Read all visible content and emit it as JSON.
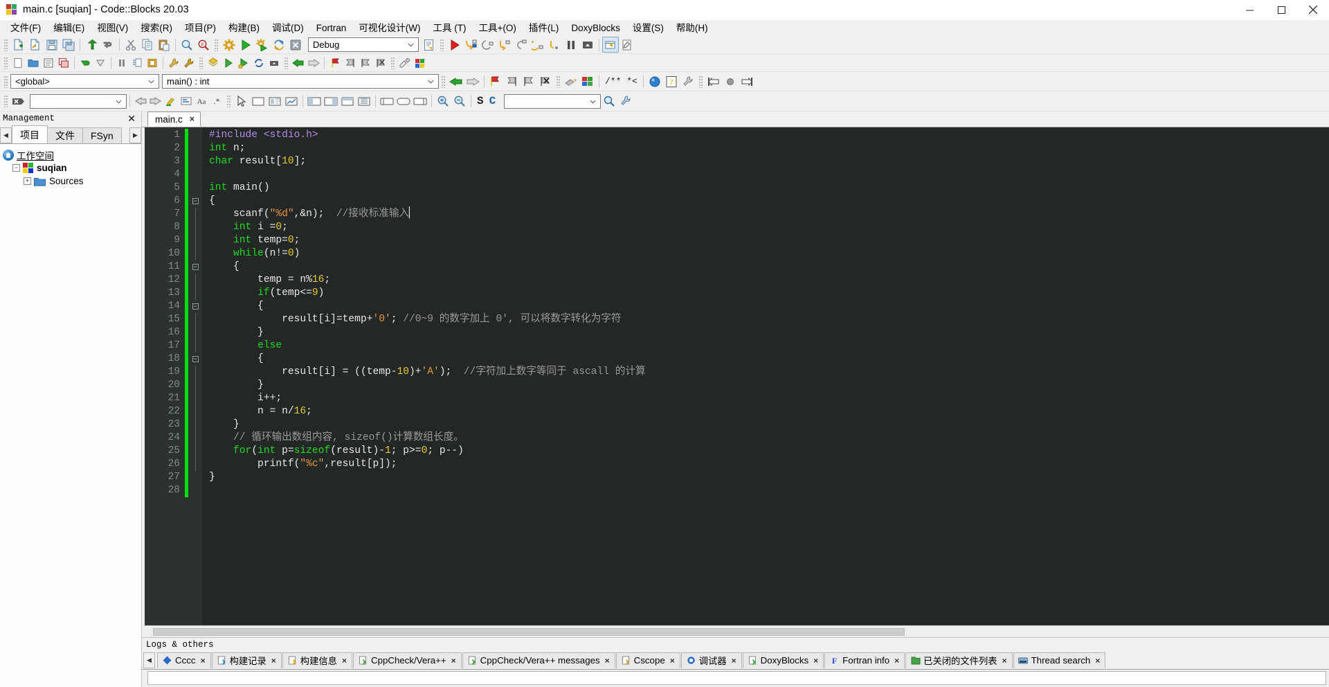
{
  "window": {
    "title": "main.c [suqian] - Code::Blocks 20.03",
    "app_icon": "codeblocks-logo-icon",
    "minimize": "minimize-button",
    "maximize": "maximize-button",
    "close": "close-button"
  },
  "menubar": {
    "items": [
      {
        "label": "文件(F)"
      },
      {
        "label": "编辑(E)"
      },
      {
        "label": "视图(V)"
      },
      {
        "label": "搜索(R)"
      },
      {
        "label": "项目(P)"
      },
      {
        "label": "构建(B)"
      },
      {
        "label": "调试(D)"
      },
      {
        "label": "Fortran"
      },
      {
        "label": "可视化设计(W)"
      },
      {
        "label": "工具 (T)"
      },
      {
        "label": "工具+(O)"
      },
      {
        "label": "插件(L)"
      },
      {
        "label": "DoxyBlocks"
      },
      {
        "label": "设置(S)"
      },
      {
        "label": "帮助(H)"
      }
    ]
  },
  "toolbar_main": {
    "icons": [
      "new-file-icon",
      "open-file-icon",
      "save-icon",
      "save-all-icon",
      "undo-icon",
      "redo-icon",
      "cut-icon",
      "copy-icon",
      "paste-icon",
      "find-icon",
      "replace-icon"
    ],
    "build_icons": [
      "build-icon",
      "run-icon",
      "build-and-run-icon",
      "rebuild-icon",
      "abort-icon"
    ],
    "target_combo": {
      "value": "Debug",
      "name": "build-target-combo"
    },
    "select_target_icon": "select-target-icon"
  },
  "toolbar_debug": {
    "icons": [
      "debug-continue-icon",
      "debug-run-to-cursor-icon",
      "debug-next-line-icon",
      "debug-step-into-icon",
      "debug-step-out-icon",
      "debug-next-instruction-icon",
      "debug-step-into-instruction-icon",
      "debug-break-icon",
      "debug-stop-icon",
      "debugging-windows-icon",
      "various-info-icon"
    ]
  },
  "toolbar_browse": {
    "scope_combo": {
      "value": "<global>",
      "name": "scope-combo"
    },
    "function_combo": {
      "value": "main() : int",
      "name": "function-combo"
    },
    "nav_icons": [
      "back-icon",
      "forward-icon"
    ],
    "bookmark_icons": [
      "toggle-bookmark-icon",
      "prev-bookmark-icon",
      "next-bookmark-icon",
      "clear-bookmarks-icon"
    ],
    "fortran_icons": [
      "fortran-workspace-icon",
      "fortran-jump-icon"
    ],
    "doxy_icons": [
      "doxyblocks-comment-icon",
      "doxyblocks-blockcomment-icon"
    ],
    "doxy_text": "/** *<",
    "doxy_run_icons": [
      "doxyblocks-run-icon",
      "doxyblocks-help-icon",
      "doxyblocks-config-icon"
    ],
    "misc_icons": [
      "align-left-icon",
      "circle-icon",
      "align-right-icon"
    ]
  },
  "toolbar_secondary": {
    "left_icons": [
      "blank-page-icon",
      "open-folder-icon",
      "list-icon",
      "windows-icon",
      "green-arrow-icon",
      "down-chevron-icon",
      "pause-icon",
      "indent-icon",
      "book-icon",
      "wrench1-icon",
      "wrench2-icon"
    ],
    "right_icons": [
      "cursor-icon",
      "rect-tool-icon",
      "image-tool-icon",
      "chart-tool-icon",
      "panel1-icon",
      "panel2-icon",
      "panel3-icon",
      "panel4-icon",
      "shape1-icon",
      "shape2-icon",
      "shape3-icon",
      "zoom-in-icon",
      "zoom-out-icon"
    ],
    "s_label": "S",
    "c_label": "C",
    "search_combo": {
      "value": "",
      "placeholder": "",
      "name": "symbol-search-combo"
    },
    "search_icons": [
      "search-go-icon",
      "search-settings-icon"
    ],
    "close_icon": "close-toolbar-icon",
    "left_combo": {
      "value": "",
      "name": "search-history-combo"
    },
    "nav_icons": [
      "back-arrow-icon",
      "forward-arrow-icon"
    ],
    "highlight_icons": [
      "highlight-icon",
      "selection-icon",
      "case-icon",
      "regex-icon"
    ]
  },
  "sidebar": {
    "panel_title": "Management",
    "close_icon": "close-panel-icon",
    "tabs": [
      {
        "label": "项目",
        "selected": true
      },
      {
        "label": "文件",
        "selected": false
      },
      {
        "label": "FSyn",
        "selected": false
      }
    ],
    "scroll_left_icon": "scroll-left-icon",
    "scroll_right_icon": "scroll-right-icon",
    "tree": [
      {
        "label": "工作空间",
        "icon": "workspace-home-icon",
        "level": 0,
        "style": "link"
      },
      {
        "label": "suqian",
        "icon": "codeblocks-project-icon",
        "level": 1,
        "style": "bold",
        "expander": "-"
      },
      {
        "label": "Sources",
        "icon": "folder-icon",
        "level": 2,
        "style": "normal",
        "expander": "+"
      }
    ]
  },
  "editor": {
    "tabs": [
      {
        "label": "main.c",
        "close": "×",
        "selected": true
      }
    ],
    "lines": [
      {
        "n": 1,
        "changed": true,
        "fold": "",
        "tokens": [
          {
            "t": "#include ",
            "c": "pre"
          },
          {
            "t": "<stdio.h>",
            "c": "pre"
          }
        ]
      },
      {
        "n": 2,
        "changed": true,
        "fold": "",
        "tokens": [
          {
            "t": "int",
            "c": "kw"
          },
          {
            "t": " n;",
            "c": "pun"
          }
        ]
      },
      {
        "n": 3,
        "changed": true,
        "fold": "",
        "tokens": [
          {
            "t": "char",
            "c": "kw"
          },
          {
            "t": " result[",
            "c": "pun"
          },
          {
            "t": "10",
            "c": "num"
          },
          {
            "t": "];",
            "c": "pun"
          }
        ]
      },
      {
        "n": 4,
        "changed": true,
        "fold": "",
        "tokens": []
      },
      {
        "n": 5,
        "changed": true,
        "fold": "",
        "tokens": [
          {
            "t": "int",
            "c": "kw"
          },
          {
            "t": " main()",
            "c": "pun"
          }
        ]
      },
      {
        "n": 6,
        "changed": true,
        "fold": "-",
        "tokens": [
          {
            "t": "{",
            "c": "pun"
          }
        ]
      },
      {
        "n": 7,
        "changed": true,
        "fold": "|",
        "tokens": [
          {
            "t": "    scanf(",
            "c": "pun"
          },
          {
            "t": "\"%d\"",
            "c": "str"
          },
          {
            "t": ",&n);  ",
            "c": "pun"
          },
          {
            "t": "//接收标准输入",
            "c": "cmt"
          },
          {
            "t": "▏",
            "c": "pun"
          }
        ]
      },
      {
        "n": 8,
        "changed": true,
        "fold": "|",
        "tokens": [
          {
            "t": "    ",
            "c": "pun"
          },
          {
            "t": "int",
            "c": "kw"
          },
          {
            "t": " i =",
            "c": "pun"
          },
          {
            "t": "0",
            "c": "num"
          },
          {
            "t": ";",
            "c": "pun"
          }
        ]
      },
      {
        "n": 9,
        "changed": true,
        "fold": "|",
        "tokens": [
          {
            "t": "    ",
            "c": "pun"
          },
          {
            "t": "int",
            "c": "kw"
          },
          {
            "t": " temp=",
            "c": "pun"
          },
          {
            "t": "0",
            "c": "num"
          },
          {
            "t": ";",
            "c": "pun"
          }
        ]
      },
      {
        "n": 10,
        "changed": true,
        "fold": "|",
        "tokens": [
          {
            "t": "    ",
            "c": "pun"
          },
          {
            "t": "while",
            "c": "kw"
          },
          {
            "t": "(n!=",
            "c": "pun"
          },
          {
            "t": "0",
            "c": "num"
          },
          {
            "t": ")",
            "c": "pun"
          }
        ]
      },
      {
        "n": 11,
        "changed": true,
        "fold": "-",
        "tokens": [
          {
            "t": "    {",
            "c": "pun"
          }
        ]
      },
      {
        "n": 12,
        "changed": true,
        "fold": "|",
        "tokens": [
          {
            "t": "        temp = n%",
            "c": "pun"
          },
          {
            "t": "16",
            "c": "num"
          },
          {
            "t": ";",
            "c": "pun"
          }
        ]
      },
      {
        "n": 13,
        "changed": true,
        "fold": "|",
        "tokens": [
          {
            "t": "        ",
            "c": "pun"
          },
          {
            "t": "if",
            "c": "kw"
          },
          {
            "t": "(temp<=",
            "c": "pun"
          },
          {
            "t": "9",
            "c": "num"
          },
          {
            "t": ")",
            "c": "pun"
          }
        ]
      },
      {
        "n": 14,
        "changed": true,
        "fold": "-",
        "tokens": [
          {
            "t": "        {",
            "c": "pun"
          }
        ]
      },
      {
        "n": 15,
        "changed": true,
        "fold": "|",
        "tokens": [
          {
            "t": "            result[i]=temp+",
            "c": "pun"
          },
          {
            "t": "'0'",
            "c": "str"
          },
          {
            "t": "; ",
            "c": "pun"
          },
          {
            "t": "//0~9 的数字加上 0', 可以将数字转化为字符",
            "c": "cmt"
          }
        ]
      },
      {
        "n": 16,
        "changed": true,
        "fold": "|",
        "tokens": [
          {
            "t": "        }",
            "c": "pun"
          }
        ]
      },
      {
        "n": 17,
        "changed": true,
        "fold": "|",
        "tokens": [
          {
            "t": "        ",
            "c": "pun"
          },
          {
            "t": "else",
            "c": "kw"
          }
        ]
      },
      {
        "n": 18,
        "changed": true,
        "fold": "-",
        "tokens": [
          {
            "t": "        {",
            "c": "pun"
          }
        ]
      },
      {
        "n": 19,
        "changed": true,
        "fold": "|",
        "tokens": [
          {
            "t": "            result[i] = ((temp-",
            "c": "pun"
          },
          {
            "t": "10",
            "c": "num"
          },
          {
            "t": ")+",
            "c": "pun"
          },
          {
            "t": "'A'",
            "c": "str"
          },
          {
            "t": ");  ",
            "c": "pun"
          },
          {
            "t": "//字符加上数字等同于 ascall 的计算",
            "c": "cmt"
          }
        ]
      },
      {
        "n": 20,
        "changed": true,
        "fold": "|",
        "tokens": [
          {
            "t": "        }",
            "c": "pun"
          }
        ]
      },
      {
        "n": 21,
        "changed": true,
        "fold": "|",
        "tokens": [
          {
            "t": "        i++;",
            "c": "pun"
          }
        ]
      },
      {
        "n": 22,
        "changed": true,
        "fold": "|",
        "tokens": [
          {
            "t": "        n = n/",
            "c": "pun"
          },
          {
            "t": "16",
            "c": "num"
          },
          {
            "t": ";",
            "c": "pun"
          }
        ]
      },
      {
        "n": 23,
        "changed": true,
        "fold": "|",
        "tokens": [
          {
            "t": "    }",
            "c": "pun"
          }
        ]
      },
      {
        "n": 24,
        "changed": true,
        "fold": "|",
        "tokens": [
          {
            "t": "    ",
            "c": "pun"
          },
          {
            "t": "// 循环输出数组内容, sizeof()计算数组长度。",
            "c": "cmt"
          }
        ]
      },
      {
        "n": 25,
        "changed": true,
        "fold": "|",
        "tokens": [
          {
            "t": "    ",
            "c": "pun"
          },
          {
            "t": "for",
            "c": "kw"
          },
          {
            "t": "(",
            "c": "pun"
          },
          {
            "t": "int",
            "c": "kw"
          },
          {
            "t": " p=",
            "c": "pun"
          },
          {
            "t": "sizeof",
            "c": "kw"
          },
          {
            "t": "(result)-",
            "c": "pun"
          },
          {
            "t": "1",
            "c": "num"
          },
          {
            "t": "; p>=",
            "c": "pun"
          },
          {
            "t": "0",
            "c": "num"
          },
          {
            "t": "; p--)",
            "c": "pun"
          }
        ]
      },
      {
        "n": 26,
        "changed": true,
        "fold": "|",
        "tokens": [
          {
            "t": "        printf(",
            "c": "pun"
          },
          {
            "t": "\"%c\"",
            "c": "str"
          },
          {
            "t": ",result[p]);",
            "c": "pun"
          }
        ]
      },
      {
        "n": 27,
        "changed": true,
        "fold": "",
        "tokens": [
          {
            "t": "}",
            "c": "pun"
          }
        ]
      },
      {
        "n": 28,
        "changed": true,
        "fold": "",
        "tokens": []
      }
    ]
  },
  "logs": {
    "title": "Logs & others",
    "scroll_left_icon": "log-scroll-left-icon",
    "tabs": [
      {
        "label": "Cccc",
        "icon": "cccc-icon",
        "close": "×"
      },
      {
        "label": "构建记录",
        "icon": "build-log-icon",
        "close": "×"
      },
      {
        "label": "构建信息",
        "icon": "build-messages-icon",
        "close": "×"
      },
      {
        "label": "CppCheck/Vera++",
        "icon": "cppcheck-icon",
        "close": "×"
      },
      {
        "label": "CppCheck/Vera++ messages",
        "icon": "cppcheck-msg-icon",
        "close": "×"
      },
      {
        "label": "Cscope",
        "icon": "cscope-icon",
        "close": "×"
      },
      {
        "label": "调试器",
        "icon": "debugger-icon",
        "close": "×"
      },
      {
        "label": "DoxyBlocks",
        "icon": "doxyblocks-icon",
        "close": "×"
      },
      {
        "label": "Fortran info",
        "icon": "fortran-info-icon",
        "close": "×"
      },
      {
        "label": "已关闭的文件列表",
        "icon": "closed-files-icon",
        "close": "×"
      },
      {
        "label": "Thread search",
        "icon": "thread-search-icon",
        "close": "×"
      }
    ]
  },
  "colors": {
    "editor_bg": "#232827",
    "gutter_bg": "#2c3230",
    "change_marker": "#00e000",
    "keyword": "#1ddb1d",
    "preproc": "#b38ae8",
    "string": "#e8953e",
    "number": "#e8c92f",
    "comment": "#9a9a9a",
    "text": "#e8e8e8",
    "chrome": "#f0f0f0"
  }
}
